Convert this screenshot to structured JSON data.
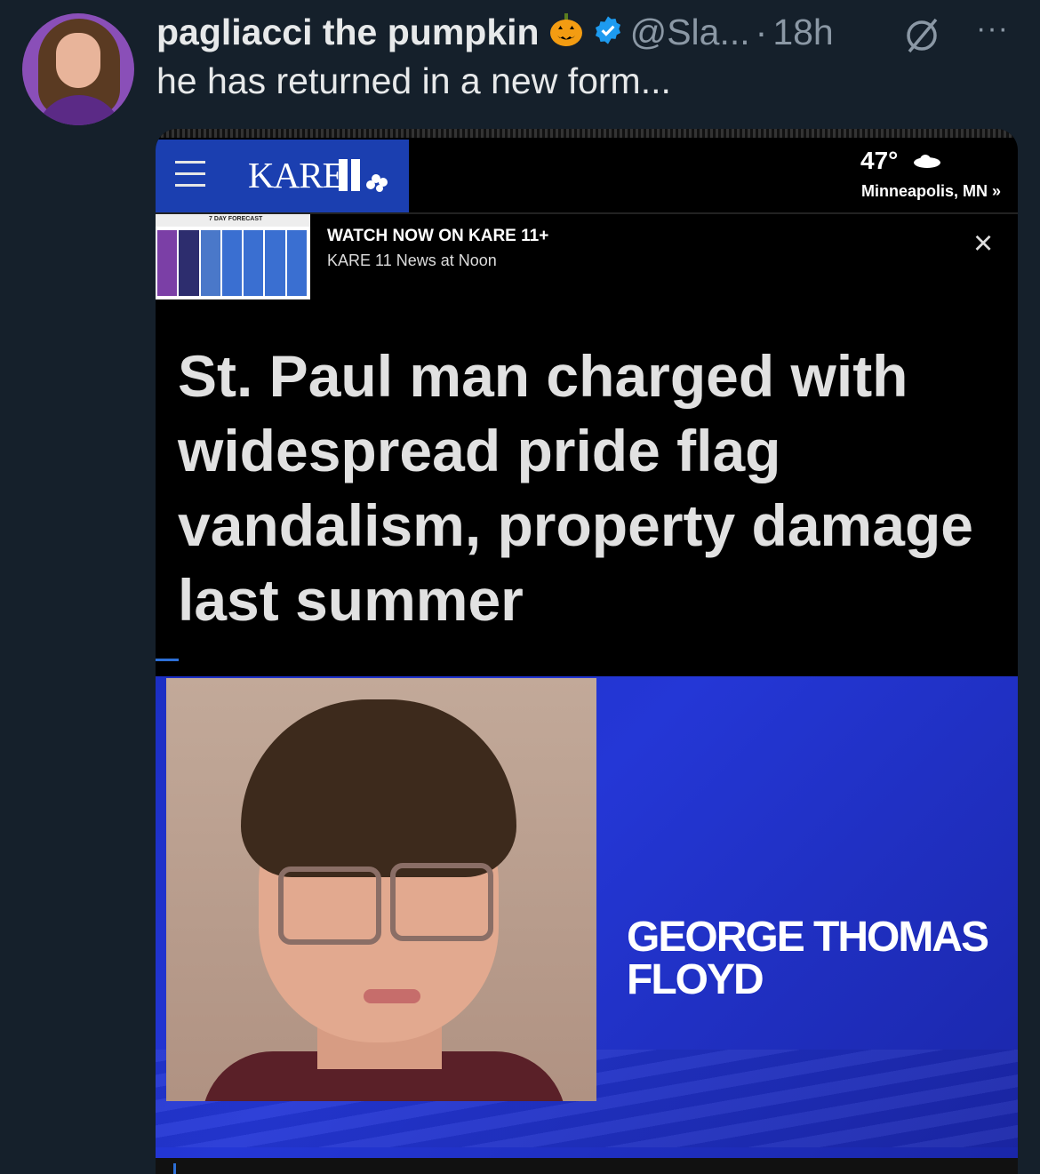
{
  "tweet": {
    "display_name": "pagliacci the pumpkin",
    "handle": "@Sla...",
    "separator": "·",
    "time": "18h",
    "more": "···",
    "text": "he has returned in a new form..."
  },
  "embedded_news": {
    "station": "KARE",
    "weather": {
      "temperature": "47°",
      "location": "Minneapolis, MN »"
    },
    "thumbnail_title": "7 DAY FORECAST",
    "watch_now": "WATCH NOW ON KARE 11+",
    "program": "KARE 11 News at Noon",
    "close": "×",
    "headline": "St. Paul man charged with widespread pride flag vandalism, property damage last summer",
    "nameplate": "GEORGE THOMAS FLOYD"
  },
  "colors": {
    "background": "#15202b",
    "kare_blue": "#1b3fb0",
    "verified": "#1d9bf0"
  }
}
